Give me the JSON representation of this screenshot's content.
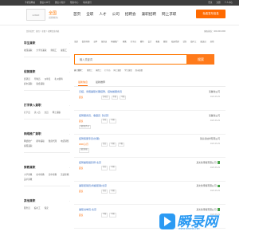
{
  "topbar": {
    "links": [
      "手机版网站",
      "微信公众号",
      "微信小程序",
      "帮助中心",
      "联系我们"
    ],
    "right": [
      "登录",
      "注册",
      "个人中心"
    ]
  },
  "header": {
    "logo": "LOGO",
    "city": "全国",
    "city_switch": "[切换城市]",
    "nav": [
      "首页",
      "全职",
      "人才",
      "公司",
      "招聘会",
      "兼职招聘",
      "网上求职"
    ],
    "post_button": "免费发布信息"
  },
  "crumb": {
    "left": "您的位置：首页 > 全职 > 招聘信息列表",
    "right": "客服热线：400-000-0000"
  },
  "sidebar": [
    {
      "title": "学生兼职",
      "items": [
        "校园兼职",
        "大学生兼职",
        "寒假工",
        "暑假工"
      ]
    },
    {
      "title": "促销兼职",
      "items": [
        "促销员",
        "导购员",
        "派单员",
        "礼仪模特",
        "超市兼职",
        "展会兼职"
      ]
    },
    {
      "title": "打字录入兼职",
      "items": [
        "打字员",
        "录入员",
        "文员",
        "网上兼职"
      ]
    },
    {
      "title": "网络推广兼职",
      "items": [
        "网络推广",
        "刷单兼职",
        "微商代理",
        "电话销售",
        "客服兼职"
      ]
    },
    {
      "title": "家教兼职",
      "items": [
        "小学家教",
        "初中家教",
        "高中家教",
        "英语家教",
        "美术家教"
      ]
    },
    {
      "title": "其他兼职",
      "items": [
        "服务员",
        "临时工",
        "保安"
      ]
    }
  ],
  "categories": [
    "全部",
    "促销导购",
    "派单",
    "服务员",
    "网络推广",
    "家教",
    "打字员",
    "模特",
    "会计",
    "客服",
    "翻译",
    "校园代理",
    "话务",
    "临时工",
    "配送员",
    "其他"
  ],
  "search": {
    "placeholder": "输入关键词",
    "button": "搜索"
  },
  "hot": {
    "label": "热门搜索：",
    "items": [
      "寒假工",
      "暑假工",
      "打字员",
      "网上兼职",
      "学生兼职",
      "周末兼职"
    ]
  },
  "tabs": [
    "最新信息",
    "最新推荐"
  ],
  "listings": [
    {
      "title": "日结，寒假兼职长期招聘，招快餐服务员",
      "salary": "面议",
      "tags": [
        "包吃住",
        "不限",
        "不限"
      ],
      "company": "某餐饮公司",
      "date": "2023-06-29",
      "badge": false,
      "tag2": []
    },
    {
      "title": "招聘服务员、收银员【北京】",
      "salary": "面议",
      "tags": [
        "包吃",
        "不限"
      ],
      "company": "某餐饮公司",
      "date": "2023-06-29",
      "badge": false,
      "tag2": [
        "兼职服务员"
      ]
    },
    {
      "title": "招聘客服专员(长期)",
      "salary": "3000元/月",
      "tags": [
        "包住",
        "不限",
        "不限"
      ],
      "company": "某信息技术有限公司",
      "date": "2023-06-29",
      "badge": false,
      "tag2": [
        "兼职客服"
      ]
    },
    {
      "title": "招聘兼职摄影师-北京",
      "salary": "面议",
      "tags": [
        "包住",
        "不限"
      ],
      "company": "某文化传媒有限公司",
      "date": "2023-06-29",
      "badge": true,
      "tag2": []
    },
    {
      "title": "兼职促销员(商超促销)北京",
      "salary": "面议",
      "tags": [
        "包住",
        "不限"
      ],
      "company": "某文化传媒有限公司",
      "date": "2023-06-29",
      "badge": true,
      "tag2": []
    },
    {
      "title": "兼职派单员-北京",
      "salary": "面议",
      "tags": [
        "不限",
        "不限"
      ],
      "company": "某文化传媒有限公司",
      "date": "2023-06-29",
      "badge": true,
      "tag2": []
    }
  ],
  "watermark": {
    "text": "瞬录网",
    "sub": "www.shunlu.net"
  },
  "colors": {
    "accent": "#ff6a00",
    "link": "#3a6fc4",
    "topbar": "#3e3e3e",
    "watermark": "#2b9af3"
  }
}
